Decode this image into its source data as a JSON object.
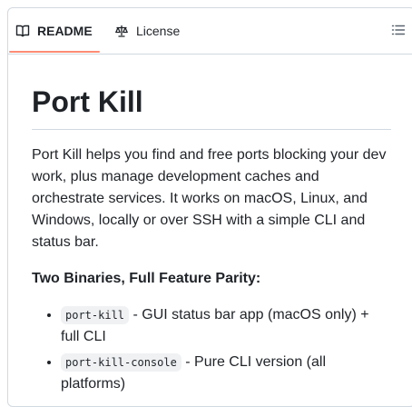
{
  "tabs": {
    "readme_label": "README",
    "license_label": "License"
  },
  "readme": {
    "title": "Port Kill",
    "description": "Port Kill helps you find and free ports blocking your dev work, plus manage development caches and orchestrate services. It works on macOS, Linux, and Windows, locally or over SSH with a simple CLI and status bar.",
    "section_heading": "Two Binaries, Full Feature Parity:",
    "binaries": [
      {
        "code": "port-kill",
        "text": " - GUI status bar app (macOS only) + full CLI"
      },
      {
        "code": "port-kill-console",
        "text": " - Pure CLI version (all platforms)"
      }
    ]
  },
  "colors": {
    "active_tab_underline": "#fd8c73",
    "border": "#d1d9e0",
    "code_background": "#eff1f3"
  }
}
